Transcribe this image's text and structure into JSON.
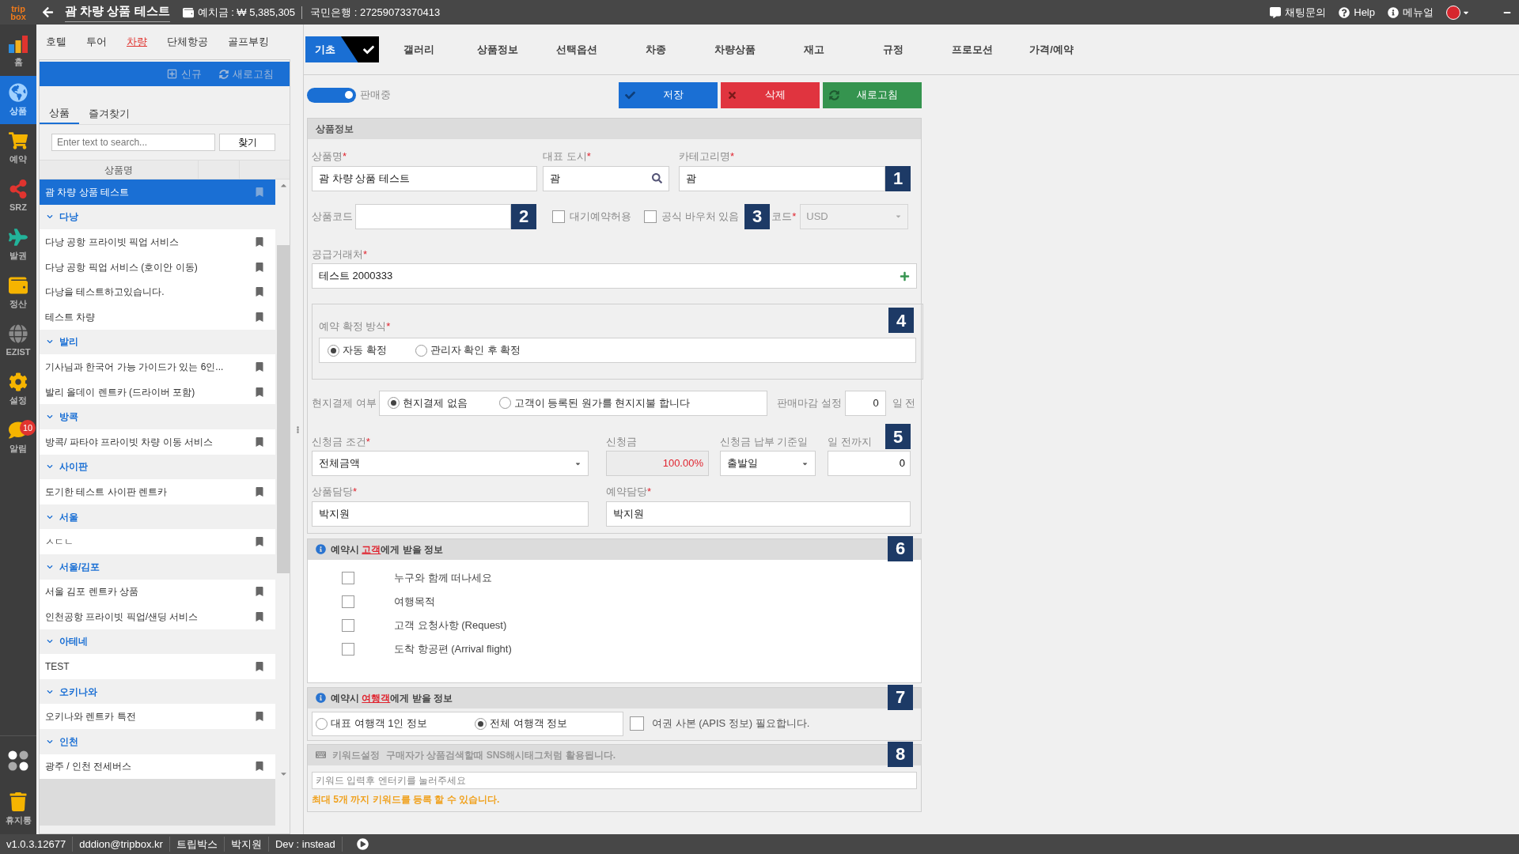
{
  "top_bar": {
    "logo": [
      "trip",
      "box"
    ],
    "title": "괌 차량 상품 테스트",
    "deposit": "예치금 : ₩ 5,385,305",
    "bank": "국민은행 : 27259073370413",
    "links": [
      {
        "label": "채팅문의",
        "kind": "chat"
      },
      {
        "label": "Help",
        "kind": "help"
      },
      {
        "label": "메뉴얼",
        "kind": "info"
      }
    ]
  },
  "rail": {
    "items": [
      {
        "label": "홈",
        "kind": "chart",
        "selected": false
      },
      {
        "label": "상품",
        "kind": "globe",
        "selected": true
      },
      {
        "label": "예약",
        "kind": "cart",
        "selected": false
      },
      {
        "label": "SRZ",
        "kind": "share",
        "selected": false
      },
      {
        "label": "발권",
        "kind": "plane",
        "selected": false
      },
      {
        "label": "정산",
        "kind": "wallet",
        "selected": false
      },
      {
        "label": "EZIST",
        "kind": "web",
        "selected": false
      },
      {
        "label": "설정",
        "kind": "gear",
        "selected": false
      },
      {
        "label": "알림",
        "kind": "bell",
        "selected": false,
        "badge": "10"
      }
    ],
    "bottom": [
      {
        "kind": "apps"
      },
      {
        "label": "휴지통",
        "kind": "trash"
      }
    ]
  },
  "category_tabs": [
    {
      "label": "호텔",
      "selected": false
    },
    {
      "label": "투어",
      "selected": false
    },
    {
      "label": "차량",
      "selected": true
    },
    {
      "label": "단체항공",
      "selected": false
    },
    {
      "label": "골프부킹",
      "selected": false
    }
  ],
  "panel": {
    "actions": [
      {
        "label": "신규",
        "kind": "new"
      },
      {
        "label": "새로고침",
        "kind": "refresh"
      }
    ],
    "tabs": [
      {
        "label": "상품",
        "selected": true
      },
      {
        "label": "즐겨찾기",
        "selected": false
      }
    ],
    "search": {
      "placeholder": "Enter text to search...",
      "button": "찾기"
    },
    "column": "상품명",
    "tree": [
      {
        "kind": "item",
        "label": "괌 차량 상품 테스트",
        "selected": true
      },
      {
        "kind": "group",
        "label": "다낭",
        "expanded": true,
        "children": [
          {
            "label": "다낭 공항 프라이빗 픽업 서비스",
            "selected": false
          },
          {
            "label": "다낭 공항 픽업 서비스 (호이안 이동)",
            "selected": false
          },
          {
            "label": "다낭을 테스트하고있습니다.",
            "selected": false
          },
          {
            "label": "테스트 차량",
            "selected": false
          }
        ]
      },
      {
        "kind": "group",
        "label": "발리",
        "expanded": true,
        "children": [
          {
            "label": "기사님과 한국어 가능 가이드가 있는 6인...",
            "selected": false
          },
          {
            "label": "발리 올데이 렌트카 (드라이버 포함)",
            "selected": false
          }
        ]
      },
      {
        "kind": "group",
        "label": "방콕",
        "expanded": true,
        "children": [
          {
            "label": "방콕/ 파타야 프라이빗 차량 이동 서비스",
            "selected": false
          }
        ]
      },
      {
        "kind": "group",
        "label": "사이판",
        "expanded": true,
        "children": [
          {
            "label": "도기한 테스트 사이판 렌트카",
            "selected": false
          }
        ]
      },
      {
        "kind": "group",
        "label": "서울",
        "expanded": true,
        "children": [
          {
            "label": "ㅅㄷㄴ",
            "selected": false
          }
        ]
      },
      {
        "kind": "group",
        "label": "서울/김포",
        "expanded": true,
        "children": [
          {
            "label": "서울 김포 렌트카 상품",
            "selected": false
          },
          {
            "label": "인천공항 프라이빗 픽업/샌딩 서비스",
            "selected": false
          }
        ]
      },
      {
        "kind": "group",
        "label": "아테네",
        "expanded": true,
        "children": [
          {
            "label": "TEST",
            "selected": false
          }
        ]
      },
      {
        "kind": "group",
        "label": "오키나와",
        "expanded": true,
        "children": [
          {
            "label": "오키나와 렌트카 특전",
            "selected": false
          }
        ]
      },
      {
        "kind": "group",
        "label": "인천",
        "expanded": true,
        "children": [
          {
            "label": "광주 / 인천 전세버스",
            "selected": false
          }
        ]
      }
    ]
  },
  "tabs": [
    {
      "label": "기초",
      "selected": true,
      "done": true
    },
    {
      "label": "갤러리",
      "selected": false,
      "done": false
    },
    {
      "label": "상품정보",
      "selected": false,
      "done": false
    },
    {
      "label": "선택옵션",
      "selected": false,
      "done": false
    },
    {
      "label": "차종",
      "selected": false,
      "done": false
    },
    {
      "label": "차량상품",
      "selected": false,
      "done": false
    },
    {
      "label": "재고",
      "selected": false,
      "done": false
    },
    {
      "label": "규정",
      "selected": false,
      "done": false
    },
    {
      "label": "프로모션",
      "selected": false,
      "done": false
    },
    {
      "label": "가격/예약",
      "selected": false,
      "done": false
    }
  ],
  "sale_toggle": {
    "label": "판매중",
    "on": true
  },
  "buttons": [
    {
      "label": "저장",
      "kind": "save"
    },
    {
      "label": "삭제",
      "kind": "delete"
    },
    {
      "label": "새로고침",
      "kind": "refresh"
    }
  ],
  "product_info": {
    "title": "상품정보",
    "name": {
      "label": "상품명",
      "required_mark": "*",
      "value": "괌 차량 상품 테스트"
    },
    "city": {
      "label": "대표 도시",
      "required_mark": "*",
      "value": "괌"
    },
    "category": {
      "label": "카테고리명",
      "required_mark": "*",
      "value": "괌",
      "marker": "1"
    },
    "code": {
      "label": "상품코드",
      "marker": "2"
    },
    "waitlist": {
      "label": "대기예약허용",
      "checked": false
    },
    "voucher": {
      "label": "공식 바우처 있음",
      "checked": false
    },
    "currency": {
      "label": "코드",
      "required_mark": "*",
      "value": "USD",
      "disabled": true,
      "marker": "3"
    },
    "supplier": {
      "label": "공급거래처",
      "required_mark": "*",
      "value": "테스트 2000333"
    },
    "confirm": {
      "label": "예약 확정 방식",
      "required_mark": "*",
      "marker": "4",
      "options": [
        {
          "label": "자동 확정",
          "selected": true
        },
        {
          "label": "관리자 확인 후 확정",
          "selected": false
        }
      ]
    },
    "onsite": {
      "label": "현지결제 여부",
      "options": [
        {
          "label": "현지결제 없음",
          "selected": true
        },
        {
          "label": "고객이 등록된 원가를 현지지불 합니다",
          "selected": false
        }
      ]
    },
    "deadline": {
      "label": "판매마감 설정",
      "value": "0",
      "unit": "일 전"
    },
    "deposit_condition": {
      "label": "신청금 조건",
      "required_mark": "*",
      "value": "전체금액"
    },
    "deposit": {
      "label": "신청금",
      "value": "100.00%"
    },
    "basis": {
      "label": "신청금 납부 기준일",
      "value": "출발일"
    },
    "days": {
      "label": "일 전까지",
      "value": "0",
      "marker": "5"
    },
    "product_manager": {
      "label": "상품담당",
      "required_mark": "*",
      "value": "박지원"
    },
    "booking_manager": {
      "label": "예약담당",
      "required_mark": "*",
      "value": "박지원"
    }
  },
  "customer_info": {
    "title": {
      "before": "예약시 ",
      "highlight": "고객",
      "after": "에게 받을 정보"
    },
    "marker": "6",
    "items": [
      {
        "label": "누구와 함께 떠나세요",
        "checked": false
      },
      {
        "label": "여행목적",
        "checked": false
      },
      {
        "label": "고객 요청사항 (Request)",
        "checked": false
      },
      {
        "label": "도착 항공편 (Arrival flight)",
        "checked": false
      }
    ]
  },
  "traveler_info": {
    "title": {
      "before": "예약시 ",
      "highlight": "여행객",
      "after": "에게 받을 정보"
    },
    "marker": "7",
    "options": [
      {
        "label": "대표 여행객 1인 정보",
        "selected": false
      },
      {
        "label": "전체 여행객 정보",
        "selected": true
      }
    ],
    "passport": {
      "label": "여권 사본 (APIS 정보) 필요합니다.",
      "checked": false
    }
  },
  "keywords": {
    "title": "키워드설정",
    "hint": "구매자가 상품검색할때 SNS해시태그처럼 활용됩니다.",
    "marker": "8",
    "placeholder": "키워드 입력후 엔터키를 눌러주세요",
    "note": "최대 5개 까지 키워드를 등록 할 수 있습니다."
  },
  "status_bar": [
    "v1.0.3.12677",
    "dddion@tripbox.kr",
    "트립박스",
    "박지원",
    "Dev : instead"
  ]
}
